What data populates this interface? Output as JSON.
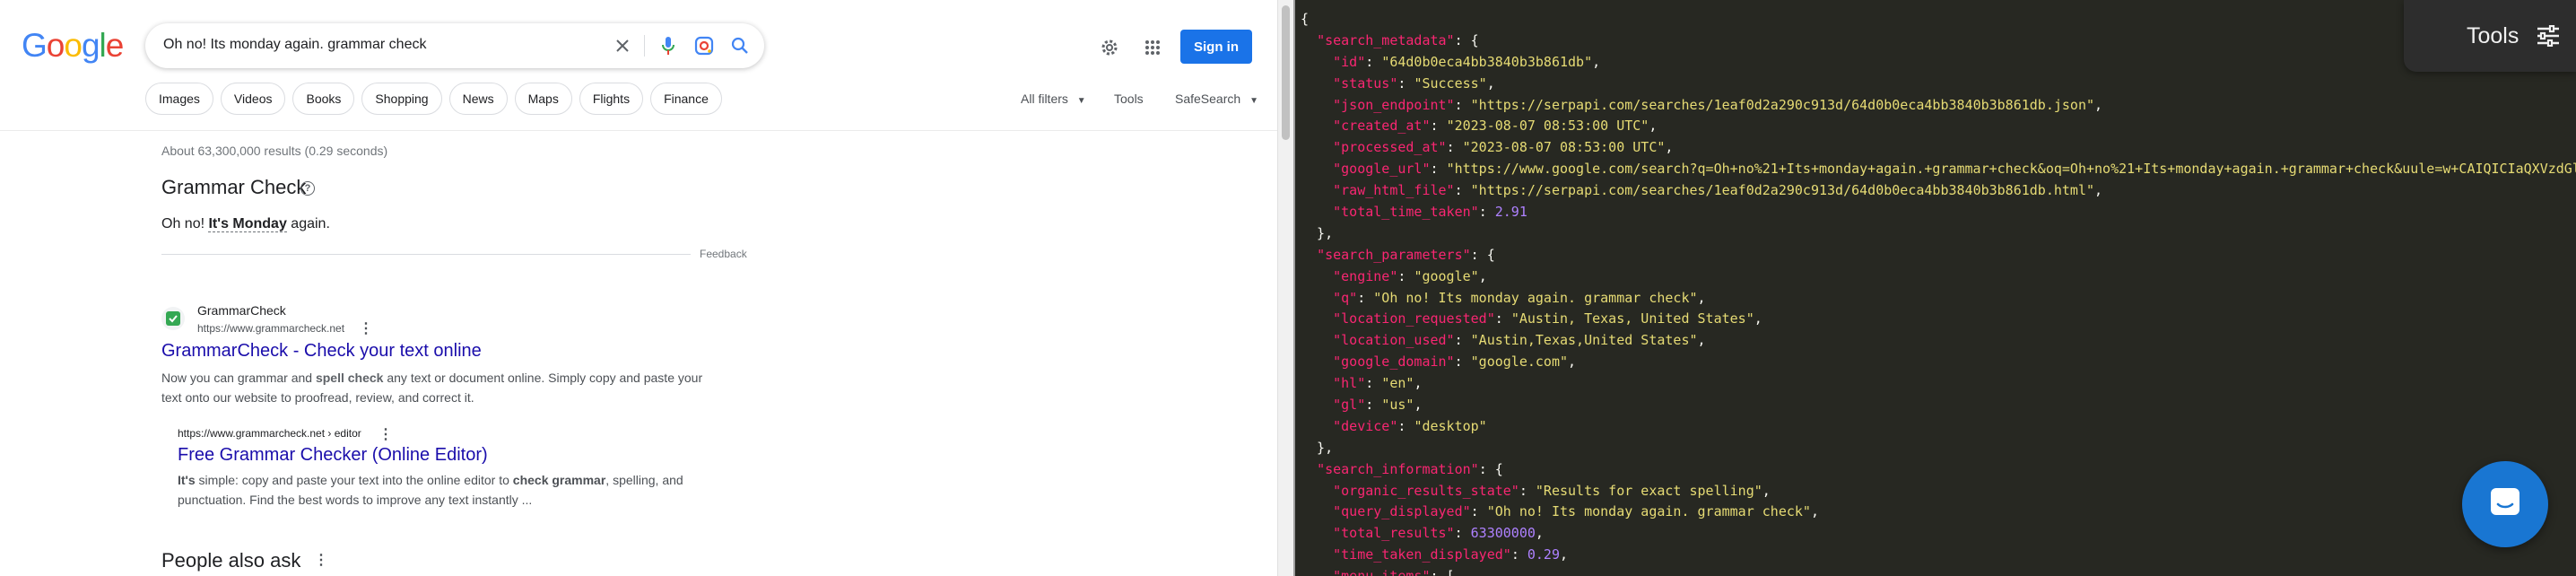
{
  "header": {
    "logo": "Google",
    "query": "Oh no! Its monday again. grammar check",
    "sign_in": "Sign in",
    "icons": [
      "close-icon",
      "mic-icon",
      "lens-icon",
      "search-icon",
      "gear-icon",
      "apps-grid-icon"
    ]
  },
  "chips": [
    "Images",
    "Videos",
    "Books",
    "Shopping",
    "News",
    "Maps",
    "Flights",
    "Finance"
  ],
  "right_tools": {
    "all_filters": "All filters",
    "tools": "Tools",
    "safesearch": "SafeSearch"
  },
  "stats": "About 63,300,000 results (0.29 seconds)",
  "grammar_check": {
    "title": "Grammar Check",
    "sentence_pre": "Oh no! ",
    "sentence_bold": "It's Monday",
    "sentence_post": " again.",
    "feedback": "Feedback"
  },
  "result1": {
    "site": "GrammarCheck",
    "url": "https://www.grammarcheck.net",
    "title": "GrammarCheck - Check your text online",
    "snippet_1": "Now you can grammar and ",
    "snippet_bold": "spell check",
    "snippet_2": " any text or document online. Simply copy and paste your text onto our website to proofread, review, and correct it."
  },
  "sublink": {
    "url": "https://www.grammarcheck.net › editor",
    "title": "Free Grammar Checker (Online Editor)",
    "snippet_bold1": "It's",
    "snippet_1": " simple: copy and paste your text into the online editor to ",
    "snippet_bold2": "check grammar",
    "snippet_2": ", spelling, and punctuation. Find the best words to improve any text instantly ..."
  },
  "paa": "People also ask",
  "tools_panel": {
    "label": "Tools"
  },
  "json_lines": [
    [
      [
        "p",
        "{"
      ]
    ],
    [
      [
        "p",
        "  "
      ],
      [
        "k",
        "\"search_metadata\""
      ],
      [
        "p",
        ": {"
      ]
    ],
    [
      [
        "p",
        "    "
      ],
      [
        "k",
        "\"id\""
      ],
      [
        "p",
        ": "
      ],
      [
        "s",
        "\"64d0b0eca4bb3840b3b861db\""
      ],
      [
        "p",
        ","
      ]
    ],
    [
      [
        "p",
        "    "
      ],
      [
        "k",
        "\"status\""
      ],
      [
        "p",
        ": "
      ],
      [
        "s",
        "\"Success\""
      ],
      [
        "p",
        ","
      ]
    ],
    [
      [
        "p",
        "    "
      ],
      [
        "k",
        "\"json_endpoint\""
      ],
      [
        "p",
        ": "
      ],
      [
        "s",
        "\"https://serpapi.com/searches/1eaf0d2a290c913d/64d0b0eca4bb3840b3b861db.json\""
      ],
      [
        "p",
        ","
      ]
    ],
    [
      [
        "p",
        "    "
      ],
      [
        "k",
        "\"created_at\""
      ],
      [
        "p",
        ": "
      ],
      [
        "s",
        "\"2023-08-07 08:53:00 UTC\""
      ],
      [
        "p",
        ","
      ]
    ],
    [
      [
        "p",
        "    "
      ],
      [
        "k",
        "\"processed_at\""
      ],
      [
        "p",
        ": "
      ],
      [
        "s",
        "\"2023-08-07 08:53:00 UTC\""
      ],
      [
        "p",
        ","
      ]
    ],
    [
      [
        "p",
        "    "
      ],
      [
        "k",
        "\"google_url\""
      ],
      [
        "p",
        ": "
      ],
      [
        "s",
        "\"https://www.google.com/search?q=Oh+no%21+Its+monday+again.+grammar+check&oq=Oh+no%21+Its+monday+again.+grammar+check&uule=w+CAIQICIaQXVzdGluLFRleGFz"
      ]
    ],
    [
      [
        "p",
        "    "
      ],
      [
        "k",
        "\"raw_html_file\""
      ],
      [
        "p",
        ": "
      ],
      [
        "s",
        "\"https://serpapi.com/searches/1eaf0d2a290c913d/64d0b0eca4bb3840b3b861db.html\""
      ],
      [
        "p",
        ","
      ]
    ],
    [
      [
        "p",
        "    "
      ],
      [
        "k",
        "\"total_time_taken\""
      ],
      [
        "p",
        ": "
      ],
      [
        "n",
        "2.91"
      ]
    ],
    [
      [
        "p",
        "  },"
      ]
    ],
    [
      [
        "p",
        "  "
      ],
      [
        "k",
        "\"search_parameters\""
      ],
      [
        "p",
        ": {"
      ]
    ],
    [
      [
        "p",
        "    "
      ],
      [
        "k",
        "\"engine\""
      ],
      [
        "p",
        ": "
      ],
      [
        "s",
        "\"google\""
      ],
      [
        "p",
        ","
      ]
    ],
    [
      [
        "p",
        "    "
      ],
      [
        "k",
        "\"q\""
      ],
      [
        "p",
        ": "
      ],
      [
        "s",
        "\"Oh no! Its monday again. grammar check\""
      ],
      [
        "p",
        ","
      ]
    ],
    [
      [
        "p",
        "    "
      ],
      [
        "k",
        "\"location_requested\""
      ],
      [
        "p",
        ": "
      ],
      [
        "s",
        "\"Austin, Texas, United States\""
      ],
      [
        "p",
        ","
      ]
    ],
    [
      [
        "p",
        "    "
      ],
      [
        "k",
        "\"location_used\""
      ],
      [
        "p",
        ": "
      ],
      [
        "s",
        "\"Austin,Texas,United States\""
      ],
      [
        "p",
        ","
      ]
    ],
    [
      [
        "p",
        "    "
      ],
      [
        "k",
        "\"google_domain\""
      ],
      [
        "p",
        ": "
      ],
      [
        "s",
        "\"google.com\""
      ],
      [
        "p",
        ","
      ]
    ],
    [
      [
        "p",
        "    "
      ],
      [
        "k",
        "\"hl\""
      ],
      [
        "p",
        ": "
      ],
      [
        "s",
        "\"en\""
      ],
      [
        "p",
        ","
      ]
    ],
    [
      [
        "p",
        "    "
      ],
      [
        "k",
        "\"gl\""
      ],
      [
        "p",
        ": "
      ],
      [
        "s",
        "\"us\""
      ],
      [
        "p",
        ","
      ]
    ],
    [
      [
        "p",
        "    "
      ],
      [
        "k",
        "\"device\""
      ],
      [
        "p",
        ": "
      ],
      [
        "s",
        "\"desktop\""
      ]
    ],
    [
      [
        "p",
        "  },"
      ]
    ],
    [
      [
        "p",
        "  "
      ],
      [
        "k",
        "\"search_information\""
      ],
      [
        "p",
        ": {"
      ]
    ],
    [
      [
        "p",
        "    "
      ],
      [
        "k",
        "\"organic_results_state\""
      ],
      [
        "p",
        ": "
      ],
      [
        "s",
        "\"Results for exact spelling\""
      ],
      [
        "p",
        ","
      ]
    ],
    [
      [
        "p",
        "    "
      ],
      [
        "k",
        "\"query_displayed\""
      ],
      [
        "p",
        ": "
      ],
      [
        "s",
        "\"Oh no! Its monday again. grammar check\""
      ],
      [
        "p",
        ","
      ]
    ],
    [
      [
        "p",
        "    "
      ],
      [
        "k",
        "\"total_results\""
      ],
      [
        "p",
        ": "
      ],
      [
        "n",
        "63300000"
      ],
      [
        "p",
        ","
      ]
    ],
    [
      [
        "p",
        "    "
      ],
      [
        "k",
        "\"time_taken_displayed\""
      ],
      [
        "p",
        ": "
      ],
      [
        "n",
        "0.29"
      ],
      [
        "p",
        ","
      ]
    ],
    [
      [
        "p",
        "    "
      ],
      [
        "k",
        "\"menu_items\""
      ],
      [
        "p",
        ": ["
      ]
    ]
  ],
  "colors": {
    "link": "#1a0dab",
    "accent": "#1a73e8",
    "json_bg": "#272822",
    "json_key": "#f92672",
    "json_string": "#e6db74",
    "json_number": "#ae81ff"
  }
}
